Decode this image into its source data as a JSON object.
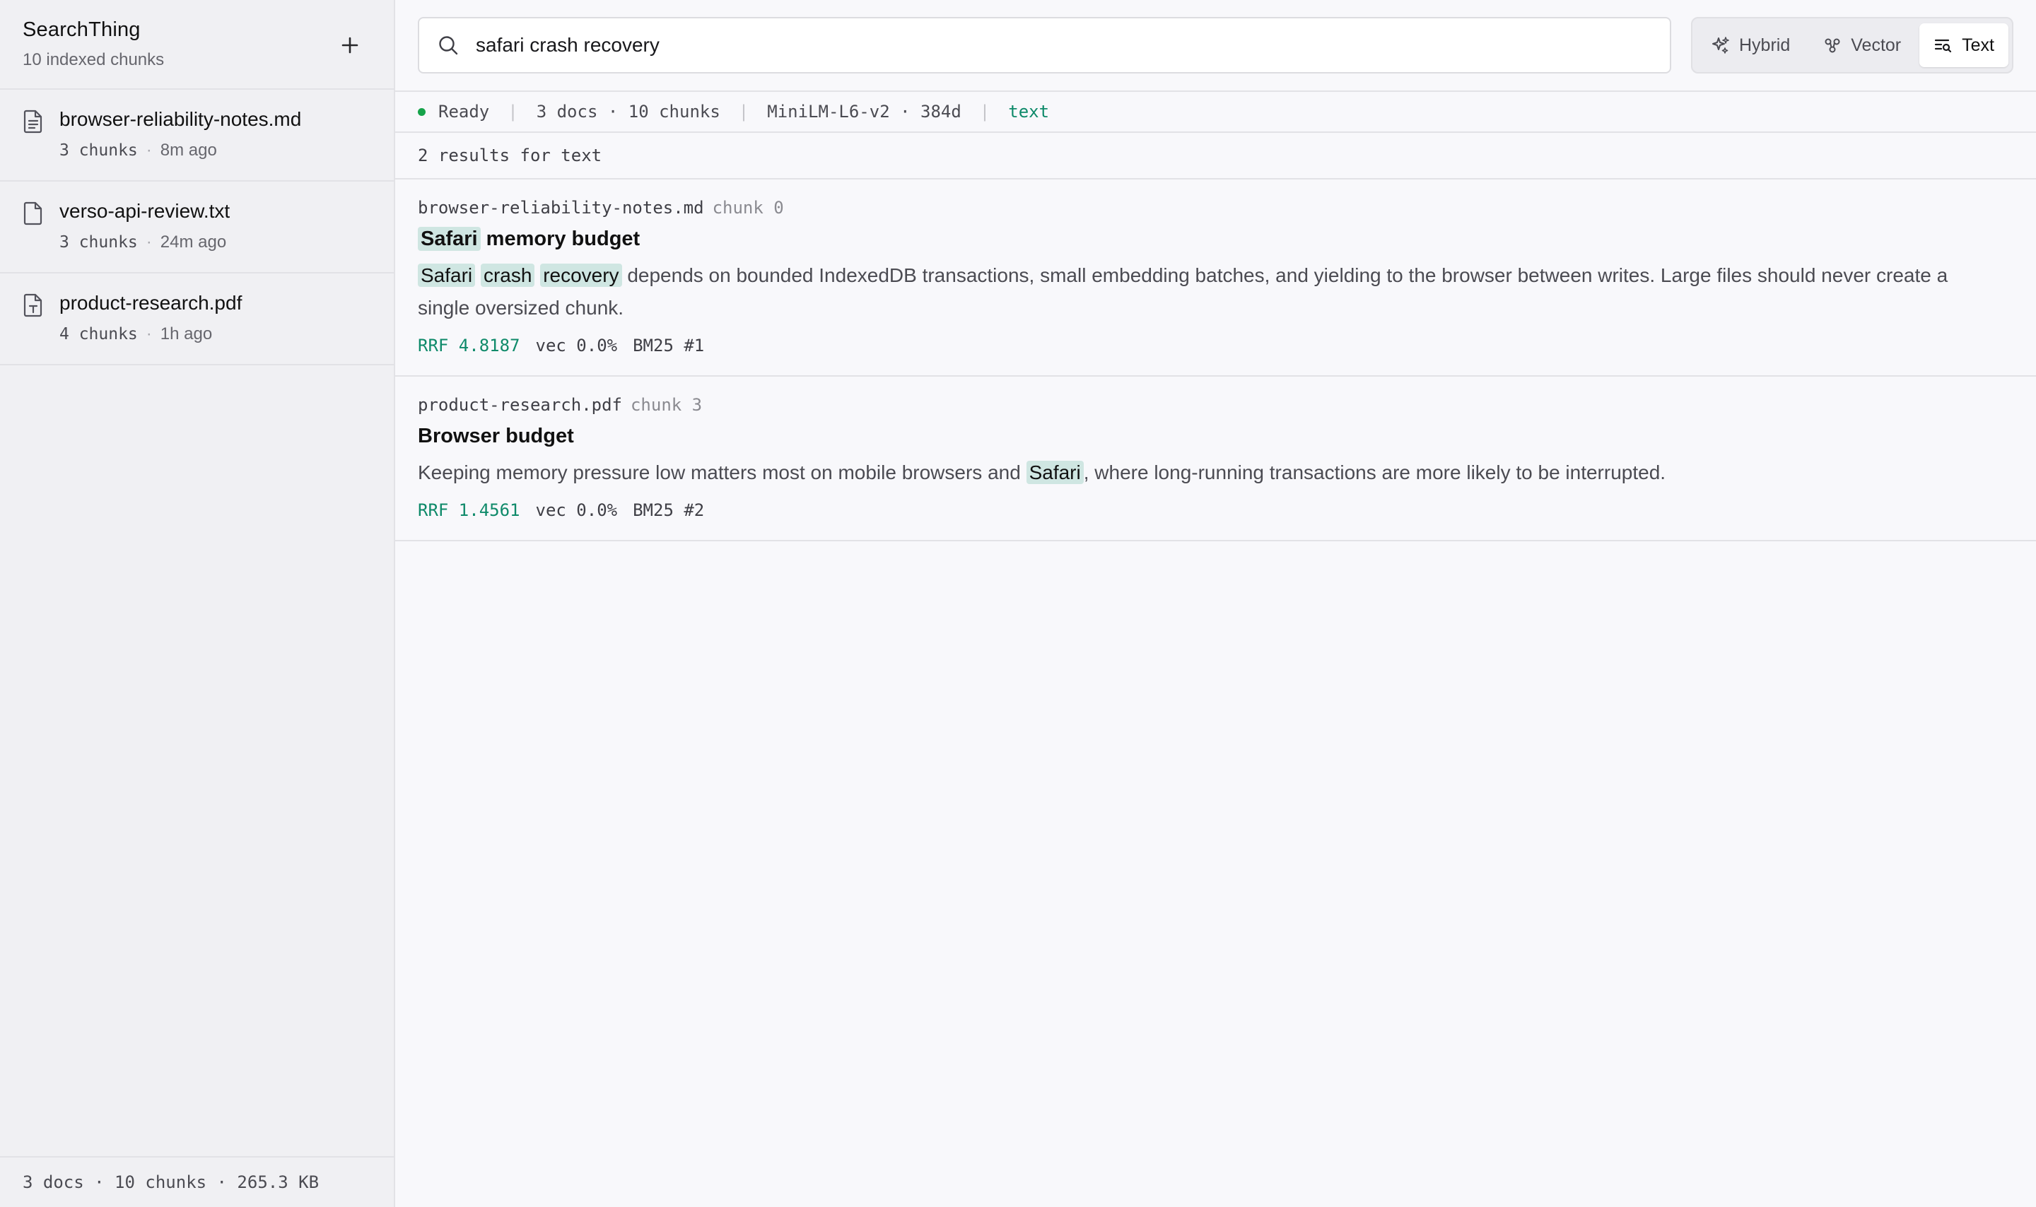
{
  "sidebar": {
    "title": "SearchThing",
    "subtitle": "10 indexed chunks",
    "docs": [
      {
        "name": "browser-reliability-notes.md",
        "chunks": "3 chunks",
        "time": "8m ago",
        "icon": "markdown-file-icon"
      },
      {
        "name": "verso-api-review.txt",
        "chunks": "3 chunks",
        "time": "24m ago",
        "icon": "text-file-icon"
      },
      {
        "name": "product-research.pdf",
        "chunks": "4 chunks",
        "time": "1h ago",
        "icon": "pdf-file-icon"
      }
    ],
    "footer": "3 docs · 10 chunks · 265.3 KB"
  },
  "search": {
    "value": "safari crash recovery",
    "placeholder": ""
  },
  "modes": [
    {
      "label": "Hybrid",
      "icon": "sparkles-icon",
      "active": false
    },
    {
      "label": "Vector",
      "icon": "vector-icon",
      "active": false
    },
    {
      "label": "Text",
      "icon": "text-search-icon",
      "active": true
    }
  ],
  "status": {
    "state": "Ready",
    "counts": "3 docs · 10 chunks",
    "model": "MiniLM-L6-v2 · 384d",
    "mode": "text"
  },
  "results_summary": "2 results for text",
  "results": [
    {
      "source": "browser-reliability-notes.md",
      "chunk": "chunk 0",
      "title_highlight": "Safari",
      "title_rest": " memory budget",
      "body_hl1": "Safari",
      "body_hl2": "crash",
      "body_hl3": "recovery",
      "body_rest": " depends on bounded IndexedDB transactions, small embedding batches, and yielding to the browser between writes. Large files should never create a single oversized chunk.",
      "rrf": "RRF 4.8187",
      "vec": "vec 0.0%",
      "bm25": "BM25 #1"
    },
    {
      "source": "product-research.pdf",
      "chunk": "chunk 3",
      "title": "Browser budget",
      "body_pre": "Keeping memory pressure low matters most on mobile browsers and ",
      "body_hl": "Safari",
      "body_post": ", where long-running transactions are more likely to be interrupted.",
      "rrf": "RRF 1.4561",
      "vec": "vec 0.0%",
      "bm25": "BM25 #2"
    }
  ],
  "colors": {
    "accent": "#0f8a6a",
    "highlight": "#cfe6e2",
    "ready": "#16a34a"
  }
}
